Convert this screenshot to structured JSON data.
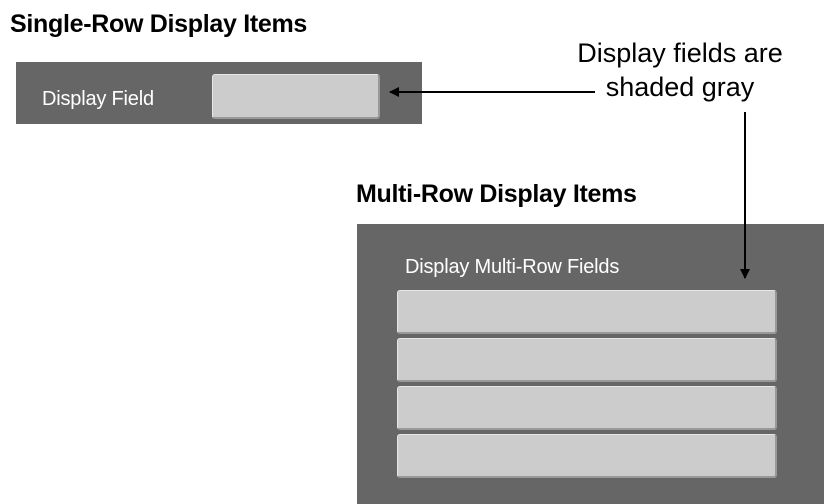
{
  "single_row": {
    "heading": "Single-Row Display Items",
    "field_label": "Display Field"
  },
  "multi_row": {
    "heading": "Multi-Row Display Items",
    "field_label": "Display Multi-Row Fields",
    "field_count": 4
  },
  "annotation": {
    "line1": "Display fields are",
    "line2": "shaded gray"
  },
  "colors": {
    "panel": "#666666",
    "field": "#cccccc",
    "label_text": "#ffffff"
  }
}
